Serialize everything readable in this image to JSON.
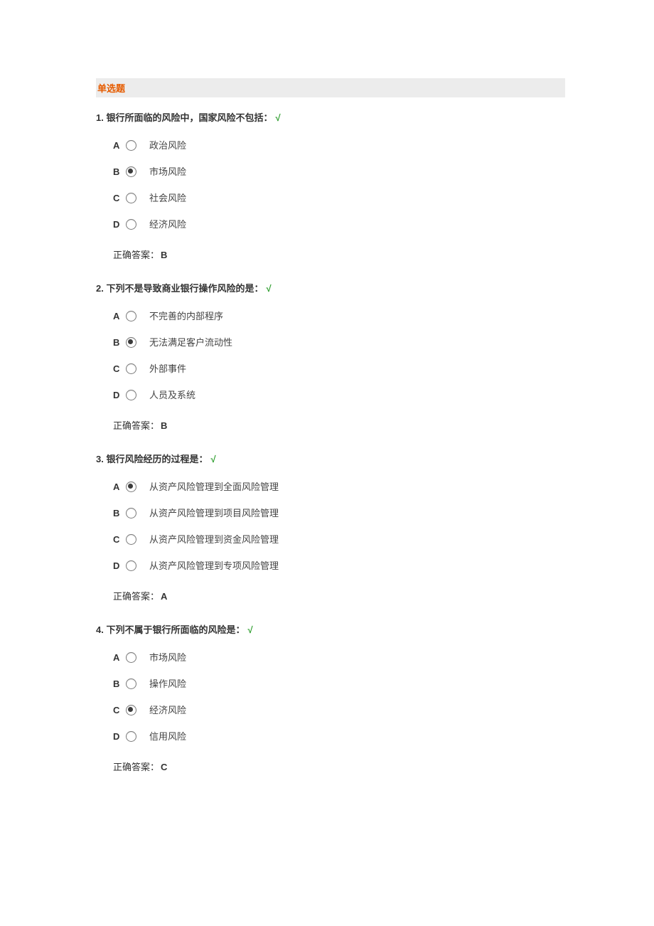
{
  "section_title": "单选题",
  "checkmark": "√",
  "answer_label": "正确答案：",
  "questions": [
    {
      "number": "1.",
      "stem": "银行所面临的风险中，国家风险不包括：",
      "options": [
        {
          "letter": "A",
          "text": "政治风险",
          "selected": false
        },
        {
          "letter": "B",
          "text": "市场风险",
          "selected": true
        },
        {
          "letter": "C",
          "text": "社会风险",
          "selected": false
        },
        {
          "letter": "D",
          "text": "经济风险",
          "selected": false
        }
      ],
      "correct": "B"
    },
    {
      "number": "2.",
      "stem": "下列不是导致商业银行操作风险的是：",
      "options": [
        {
          "letter": "A",
          "text": "不完善的内部程序",
          "selected": false
        },
        {
          "letter": "B",
          "text": "无法满足客户流动性",
          "selected": true
        },
        {
          "letter": "C",
          "text": "外部事件",
          "selected": false
        },
        {
          "letter": "D",
          "text": "人员及系统",
          "selected": false
        }
      ],
      "correct": "B"
    },
    {
      "number": "3.",
      "stem": "银行风险经历的过程是：",
      "options": [
        {
          "letter": "A",
          "text": "从资产风险管理到全面风险管理",
          "selected": true
        },
        {
          "letter": "B",
          "text": "从资产风险管理到项目风险管理",
          "selected": false
        },
        {
          "letter": "C",
          "text": "从资产风险管理到资金风险管理",
          "selected": false
        },
        {
          "letter": "D",
          "text": "从资产风险管理到专项风险管理",
          "selected": false
        }
      ],
      "correct": "A"
    },
    {
      "number": "4.",
      "stem": "下列不属于银行所面临的风险是：",
      "options": [
        {
          "letter": "A",
          "text": "市场风险",
          "selected": false
        },
        {
          "letter": "B",
          "text": "操作风险",
          "selected": false
        },
        {
          "letter": "C",
          "text": "经济风险",
          "selected": true
        },
        {
          "letter": "D",
          "text": "信用风险",
          "selected": false
        }
      ],
      "correct": "C"
    }
  ]
}
